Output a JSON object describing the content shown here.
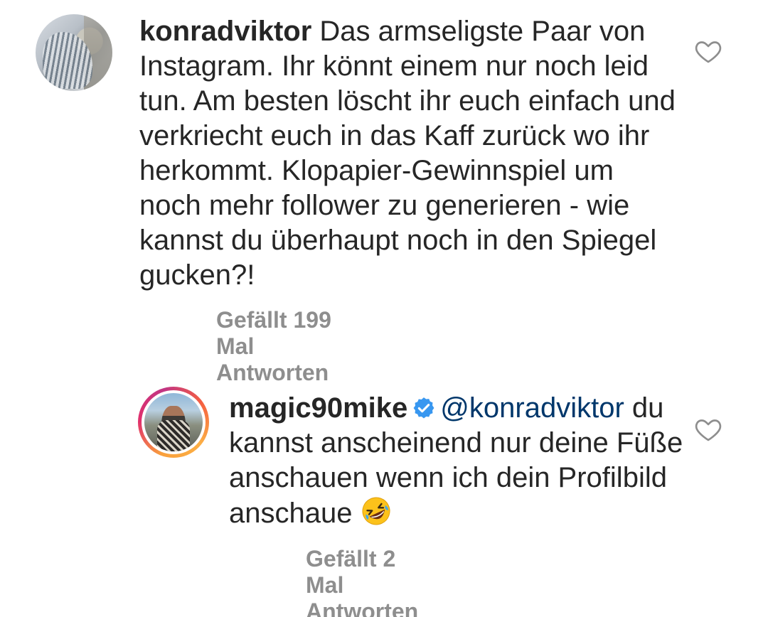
{
  "comments": [
    {
      "username": "konradviktor",
      "text": "Das armseligste Paar von Instagram. Ihr könnt einem nur noch leid tun. Am besten löscht ihr euch einfach und verkriecht euch in das Kaff zurück wo ihr herkommt. Klopapier-Gewinnspiel um noch mehr follower zu generieren - wie kannst du überhaupt noch in den Spiegel gucken?!",
      "likes": "Gefällt 199 Mal",
      "reply_label": "Antworten",
      "icon": "heart-outline-icon"
    },
    {
      "username": "magic90mike",
      "verified": true,
      "mention": "@konradviktor",
      "text": "du kannst anscheinend nur deine Füße anschauen wenn ich dein Profilbild anschaue",
      "emoji": "rolling-on-floor-laughing-emoji",
      "likes": "Gefällt 2 Mal",
      "reply_label": "Antworten",
      "icon": "heart-outline-icon"
    }
  ],
  "colors": {
    "text": "#262626",
    "meta": "#8e8e8e",
    "mention": "#00376b",
    "verified": "#3897f0"
  }
}
